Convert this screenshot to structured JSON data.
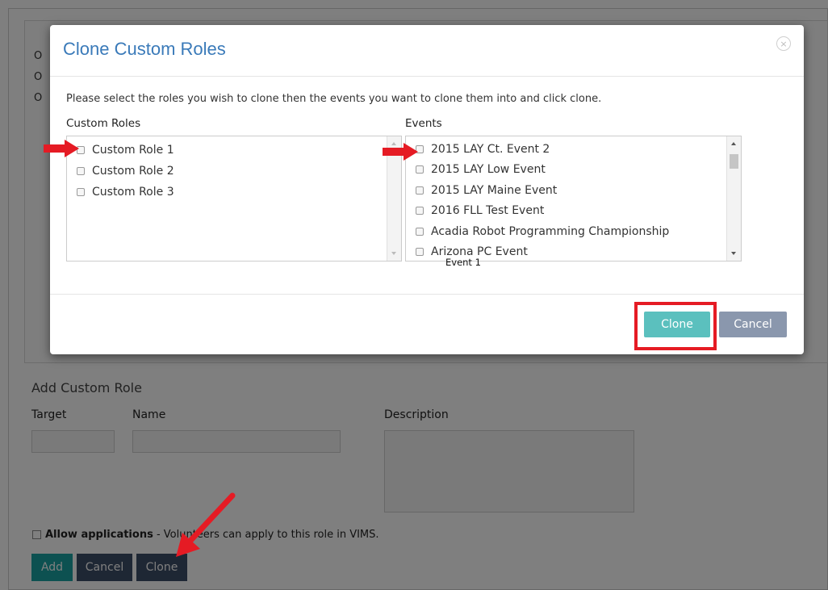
{
  "background_page": {
    "stub_letters": [
      "O",
      "O",
      "O"
    ],
    "add_custom_role": {
      "heading": "Add Custom Role",
      "target_label": "Target",
      "name_label": "Name",
      "description_label": "Description",
      "allow_applications_bold": "Allow applications",
      "allow_applications_text": " - Volunteers can apply to this role in VIMS.",
      "buttons": {
        "add": "Add",
        "cancel": "Cancel",
        "clone": "Clone"
      }
    }
  },
  "modal": {
    "title": "Clone Custom Roles",
    "close_glyph": "×",
    "instructions": "Please select the roles you wish to clone then the events you want to clone them into and click clone.",
    "custom_roles": {
      "label": "Custom Roles",
      "items": [
        "Custom Role 1",
        "Custom Role 2",
        "Custom Role 3"
      ]
    },
    "events": {
      "label": "Events",
      "items": [
        "2015 LAY Ct. Event 2",
        "2015 LAY Low Event",
        "2015 LAY Maine Event",
        "2016 FLL Test Event",
        "Acadia Robot Programming Championship",
        "Arizona PC Event"
      ]
    },
    "stray_text": "Event 1",
    "buttons": {
      "clone": "Clone",
      "cancel": "Cancel"
    }
  },
  "colors": {
    "title_blue": "#3a7ab9",
    "clone_teal": "#5bc0be",
    "cancel_slate": "#8a97ad",
    "annotation_red": "#e51b24",
    "bg_add_teal": "#1aa3a3",
    "bg_cancel_slate": "#3d4e68"
  }
}
